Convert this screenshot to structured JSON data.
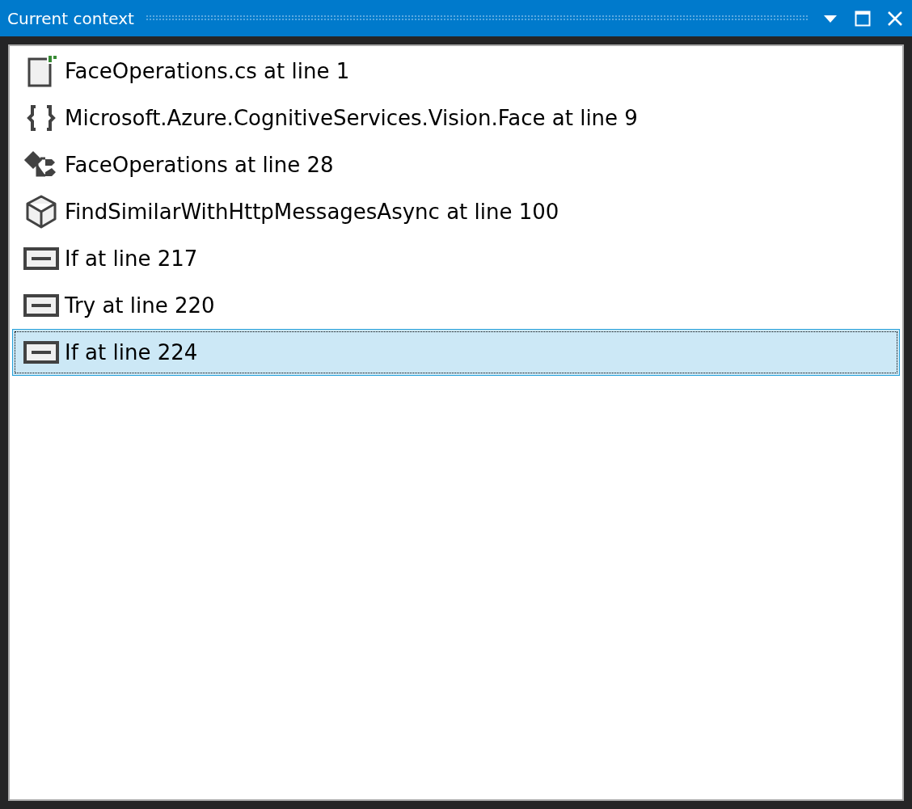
{
  "window": {
    "title": "Current context"
  },
  "items": [
    {
      "kind": "file",
      "label": "FaceOperations.cs at line 1",
      "selected": false
    },
    {
      "kind": "namespace",
      "label": "Microsoft.Azure.CognitiveServices.Vision.Face at line 9",
      "selected": false
    },
    {
      "kind": "class",
      "label": "FaceOperations at line 28",
      "selected": false
    },
    {
      "kind": "method",
      "label": "FindSimilarWithHttpMessagesAsync at line 100",
      "selected": false
    },
    {
      "kind": "block",
      "label": "If at line 217",
      "selected": false
    },
    {
      "kind": "block",
      "label": "Try at line 220",
      "selected": false
    },
    {
      "kind": "block",
      "label": "If at line 224",
      "selected": true
    }
  ]
}
